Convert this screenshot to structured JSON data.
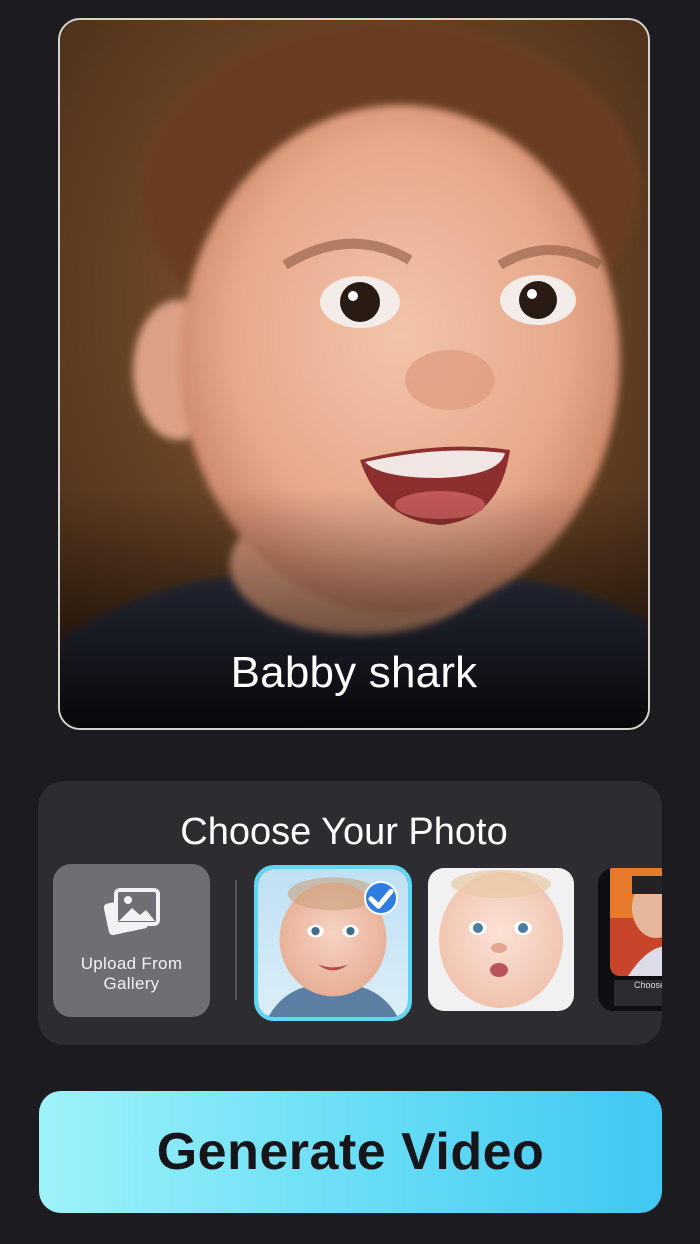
{
  "preview": {
    "caption": "Babby shark"
  },
  "choose": {
    "title": "Choose Your Photo",
    "upload_label": "Upload From Gallery",
    "upload_icon": "gallery-icon",
    "selected_index": 0,
    "thumb3_caption": "Choose"
  },
  "generate": {
    "label": "Generate Video"
  },
  "colors": {
    "background": "#1c1c20",
    "panel": "#2d2d31",
    "accent": "#5fd6f3",
    "check": "#2f7de3"
  }
}
